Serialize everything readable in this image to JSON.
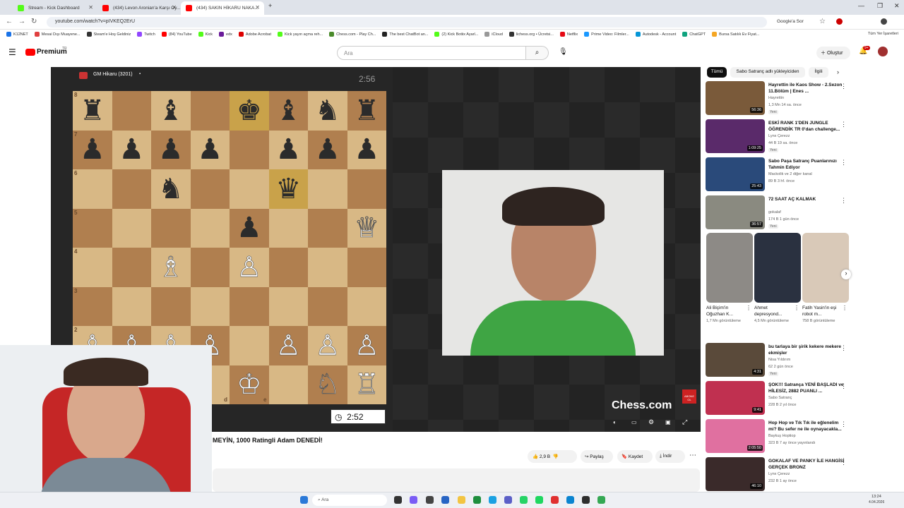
{
  "browser": {
    "tabs": [
      {
        "title": "Stream - Kick Dashboard"
      },
      {
        "title": "(434) Levon Aronian'a Karşı Oy..."
      },
      {
        "title": "(434) SAKIN HİKARU NAKA..."
      }
    ],
    "url": "youtube.com/watch?v=pIVKEQ2ErU",
    "google_label": "Google'a Sor",
    "bookmarks": [
      "K12NET",
      "Mesai Dışı Muayene...",
      "Steam'e Hoş Geldiniz",
      "Twitch",
      "(84) YouTube",
      "Kick",
      "edx",
      "Adobe Acrobat",
      "Kick yayın açma reh...",
      "Chess.com - Play Ch...",
      "The best ChatBot an...",
      "(2) Kick Botiix Ayarl...",
      "iCloud",
      "lichess.org • Ücretsi...",
      "Netflix",
      "Prime Video: Filmler...",
      "Autodesk - Account",
      "ChatGPT",
      "Bursa Satılık Ev Fiyat..."
    ],
    "all_bookmarks": "Tüm Yer İşaretleri"
  },
  "youtube": {
    "logo": "Premium",
    "logo_region": "TR",
    "search_placeholder": "Ara",
    "create_label": "Oluştur",
    "notif_count": "9+"
  },
  "player": {
    "player_name": "GM Hikaru (3201)",
    "top_clock": "2:56",
    "bottom_clock": "2:52",
    "watermark": "Chess.com",
    "abone_label": "ABONE OL",
    "ranks": [
      "8",
      "7",
      "6",
      "5",
      "4",
      "3",
      "2",
      "1"
    ],
    "files": [
      "d",
      "e"
    ],
    "board": [
      [
        "br",
        "",
        "bb",
        "",
        "bk",
        "bb",
        "bn",
        "br"
      ],
      [
        "bp",
        "bp",
        "bp",
        "bp",
        "",
        "bp",
        "bp",
        "bp"
      ],
      [
        "",
        "",
        "bn",
        "",
        "",
        "bq",
        "",
        ""
      ],
      [
        "",
        "",
        "",
        "",
        "bp",
        "",
        "",
        "wq"
      ],
      [
        "",
        "",
        "wb",
        "",
        "wp",
        "",
        "",
        ""
      ],
      [
        "",
        "",
        "",
        "",
        "",
        "",
        "",
        ""
      ],
      [
        "wp",
        "wp",
        "wp",
        "wp",
        "",
        "wp",
        "wp",
        "wp"
      ],
      [
        "",
        "",
        "",
        "",
        "wk",
        "",
        "wn",
        "wr"
      ]
    ]
  },
  "video": {
    "title": "MEYİN, 1000 Ratingli Adam DENEDİ!",
    "likes": "2,9 B",
    "share": "Paylaş",
    "save": "Kaydet",
    "download": "İndir"
  },
  "sidebar": {
    "chips": [
      "Tümü",
      "Sabo Satranç adlı yükleyiciden",
      "İlgili"
    ],
    "videos": [
      {
        "title": "Hayrettin ile Kaos Show - 2.Sezon 11.Bölüm | Enes ...",
        "channel": "Hayrettin",
        "meta": "1,3 Mn  14 sa. önce",
        "badge": "Yeni",
        "duration": "56:36",
        "color": "#7a5a3a"
      },
      {
        "title": "ESKİ RANK 1'DEN JUNGLE ÖĞRENDİK TR 0'dan challenge...",
        "channel": "Lynx Çerezz",
        "meta": "44 B  19 sa. önce",
        "badge": "Yeni",
        "duration": "1:09:25",
        "color": "#5a2a6a"
      },
      {
        "title": "Sabo Paşa Satranç Puanlarınızı Tahmin Ediyor",
        "channel": "Mackolik  ve 2 diğer kanal",
        "meta": "89 B  3 hf. önce",
        "badge": "",
        "duration": "25:43",
        "color": "#2a4a7a"
      },
      {
        "title": "72 SAAT AÇ KALMAK",
        "channel": "gokalaf",
        "meta": "174 B  1 gün önce",
        "badge": "Yeni",
        "duration": "36:57",
        "color": "#8a8a80"
      }
    ],
    "shorts": [
      {
        "title": "Ali Biçim'in Oğuzhan K...",
        "views": "1,7 Mn görüntüleme"
      },
      {
        "title": "Ahmet depresyond...",
        "views": "4,5 Mn görüntüleme"
      },
      {
        "title": "Fatih Yasin'in eşi robot m...",
        "views": "758 B görüntüleme"
      }
    ],
    "videos2": [
      {
        "title": "bu tarlaya bir şirik kekere mekere ekmişler",
        "channel": "Nisa Yıldırım",
        "meta": "62  2 gün önce",
        "badge": "Yeni",
        "duration": "4:31",
        "color": "#5a4a3a"
      },
      {
        "title": "ŞOK!!! Satrança YENİ BAŞLADI ve HİLESİZ, 2882 PUANLI ...",
        "channel": "Sabo Satranç",
        "meta": "228 B  2 yıl önce",
        "badge": "",
        "duration": "9:41",
        "color": "#c03050"
      },
      {
        "title": "Hop Hop ve Tık Tık ile eğlenelim mi? Bu sefer ne ile oynayacakla...",
        "channel": "Baykuş Hoptiop",
        "meta": "323 B  7 ay önce yayınlandı",
        "badge": "",
        "duration": "2:05:50",
        "color": "#e070a0"
      },
      {
        "title": "GOKALAF VE PANKY İLE HANGİSİ GERÇEK BRONZ",
        "channel": "Lynx Çerezz",
        "meta": "232 B  1 ay önce",
        "badge": "",
        "duration": "46:10",
        "color": "#3a2a2a"
      }
    ]
  },
  "taskbar": {
    "search": "Ara",
    "time": "13:24",
    "date": "4.04.2026"
  }
}
